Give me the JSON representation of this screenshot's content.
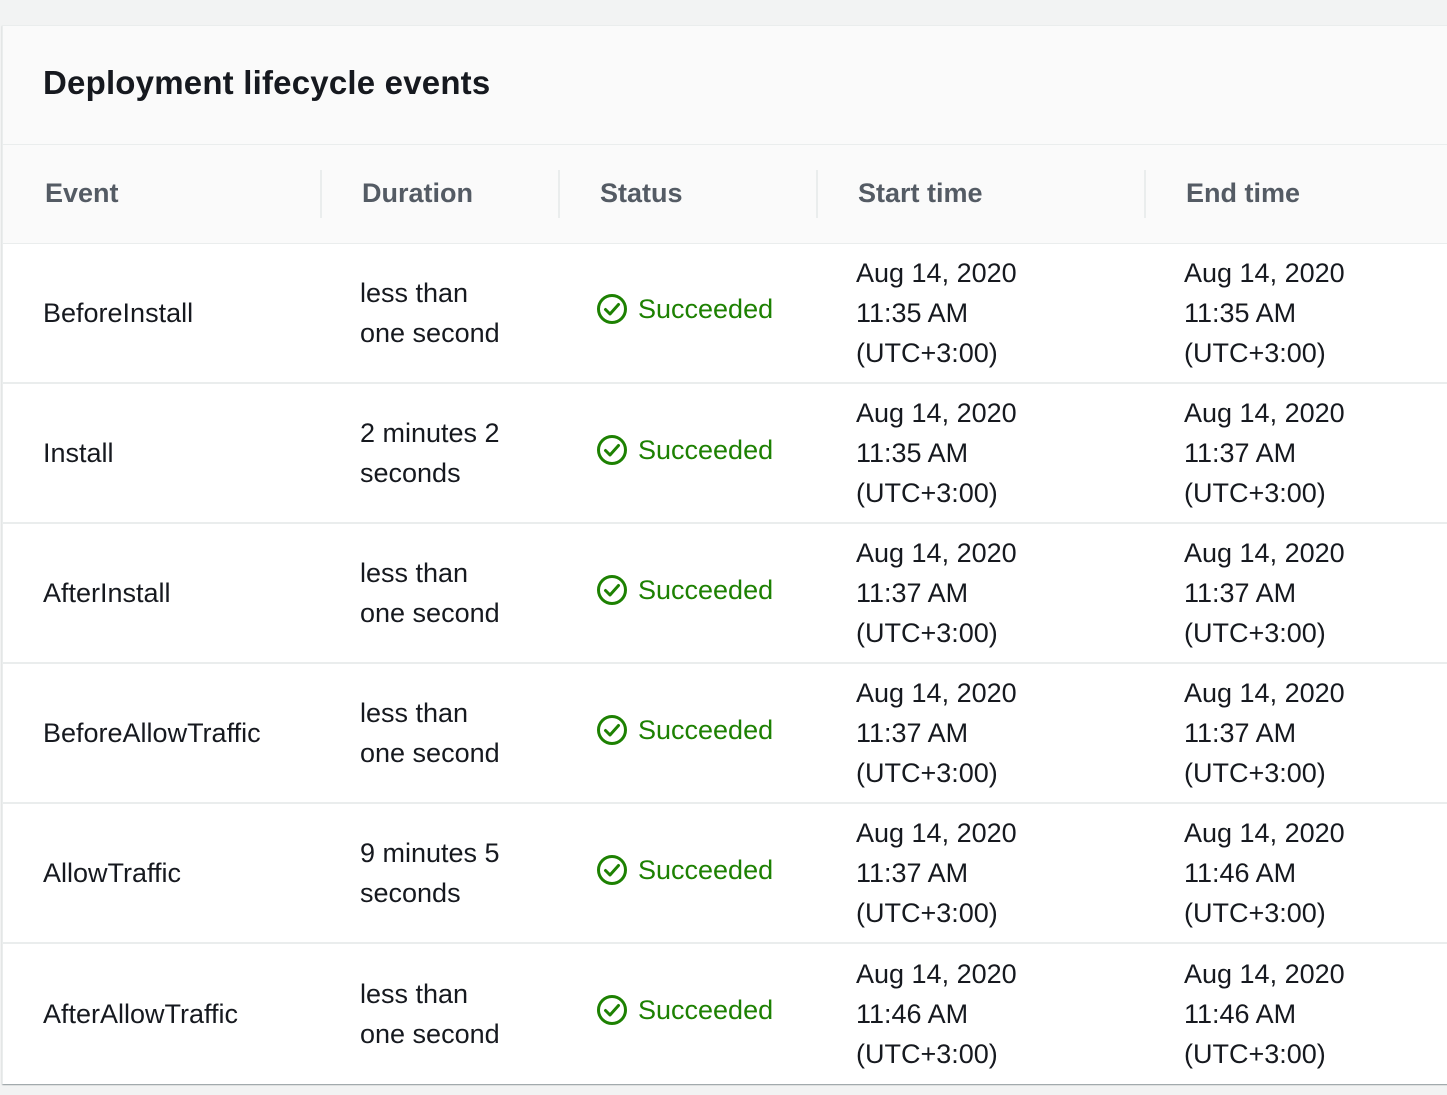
{
  "panel": {
    "title": "Deployment lifecycle events"
  },
  "table": {
    "columns": [
      "Event",
      "Duration",
      "Status",
      "Start time",
      "End time"
    ],
    "rows": [
      {
        "event": "BeforeInstall",
        "duration": "less than one second",
        "status": "Succeeded",
        "start": [
          "Aug 14, 2020",
          "11:35 AM",
          "(UTC+3:00)"
        ],
        "end": [
          "Aug 14, 2020",
          "11:35 AM",
          "(UTC+3:00)"
        ]
      },
      {
        "event": "Install",
        "duration": "2 minutes 2 seconds",
        "status": "Succeeded",
        "start": [
          "Aug 14, 2020",
          "11:35 AM",
          "(UTC+3:00)"
        ],
        "end": [
          "Aug 14, 2020",
          "11:37 AM",
          "(UTC+3:00)"
        ]
      },
      {
        "event": "AfterInstall",
        "duration": "less than one second",
        "status": "Succeeded",
        "start": [
          "Aug 14, 2020",
          "11:37 AM",
          "(UTC+3:00)"
        ],
        "end": [
          "Aug 14, 2020",
          "11:37 AM",
          "(UTC+3:00)"
        ]
      },
      {
        "event": "BeforeAllowTraffic",
        "duration": "less than one second",
        "status": "Succeeded",
        "start": [
          "Aug 14, 2020",
          "11:37 AM",
          "(UTC+3:00)"
        ],
        "end": [
          "Aug 14, 2020",
          "11:37 AM",
          "(UTC+3:00)"
        ]
      },
      {
        "event": "AllowTraffic",
        "duration": "9 minutes 5 seconds",
        "status": "Succeeded",
        "start": [
          "Aug 14, 2020",
          "11:37 AM",
          "(UTC+3:00)"
        ],
        "end": [
          "Aug 14, 2020",
          "11:46 AM",
          "(UTC+3:00)"
        ]
      },
      {
        "event": "AfterAllowTraffic",
        "duration": "less than one second",
        "status": "Succeeded",
        "start": [
          "Aug 14, 2020",
          "11:46 AM",
          "(UTC+3:00)"
        ],
        "end": [
          "Aug 14, 2020",
          "11:46 AM",
          "(UTC+3:00)"
        ]
      }
    ]
  },
  "icons": {
    "status": "success-check-circle-icon"
  },
  "colors": {
    "success": "#1d8102",
    "header_text": "#545b64",
    "text": "#16191f"
  }
}
